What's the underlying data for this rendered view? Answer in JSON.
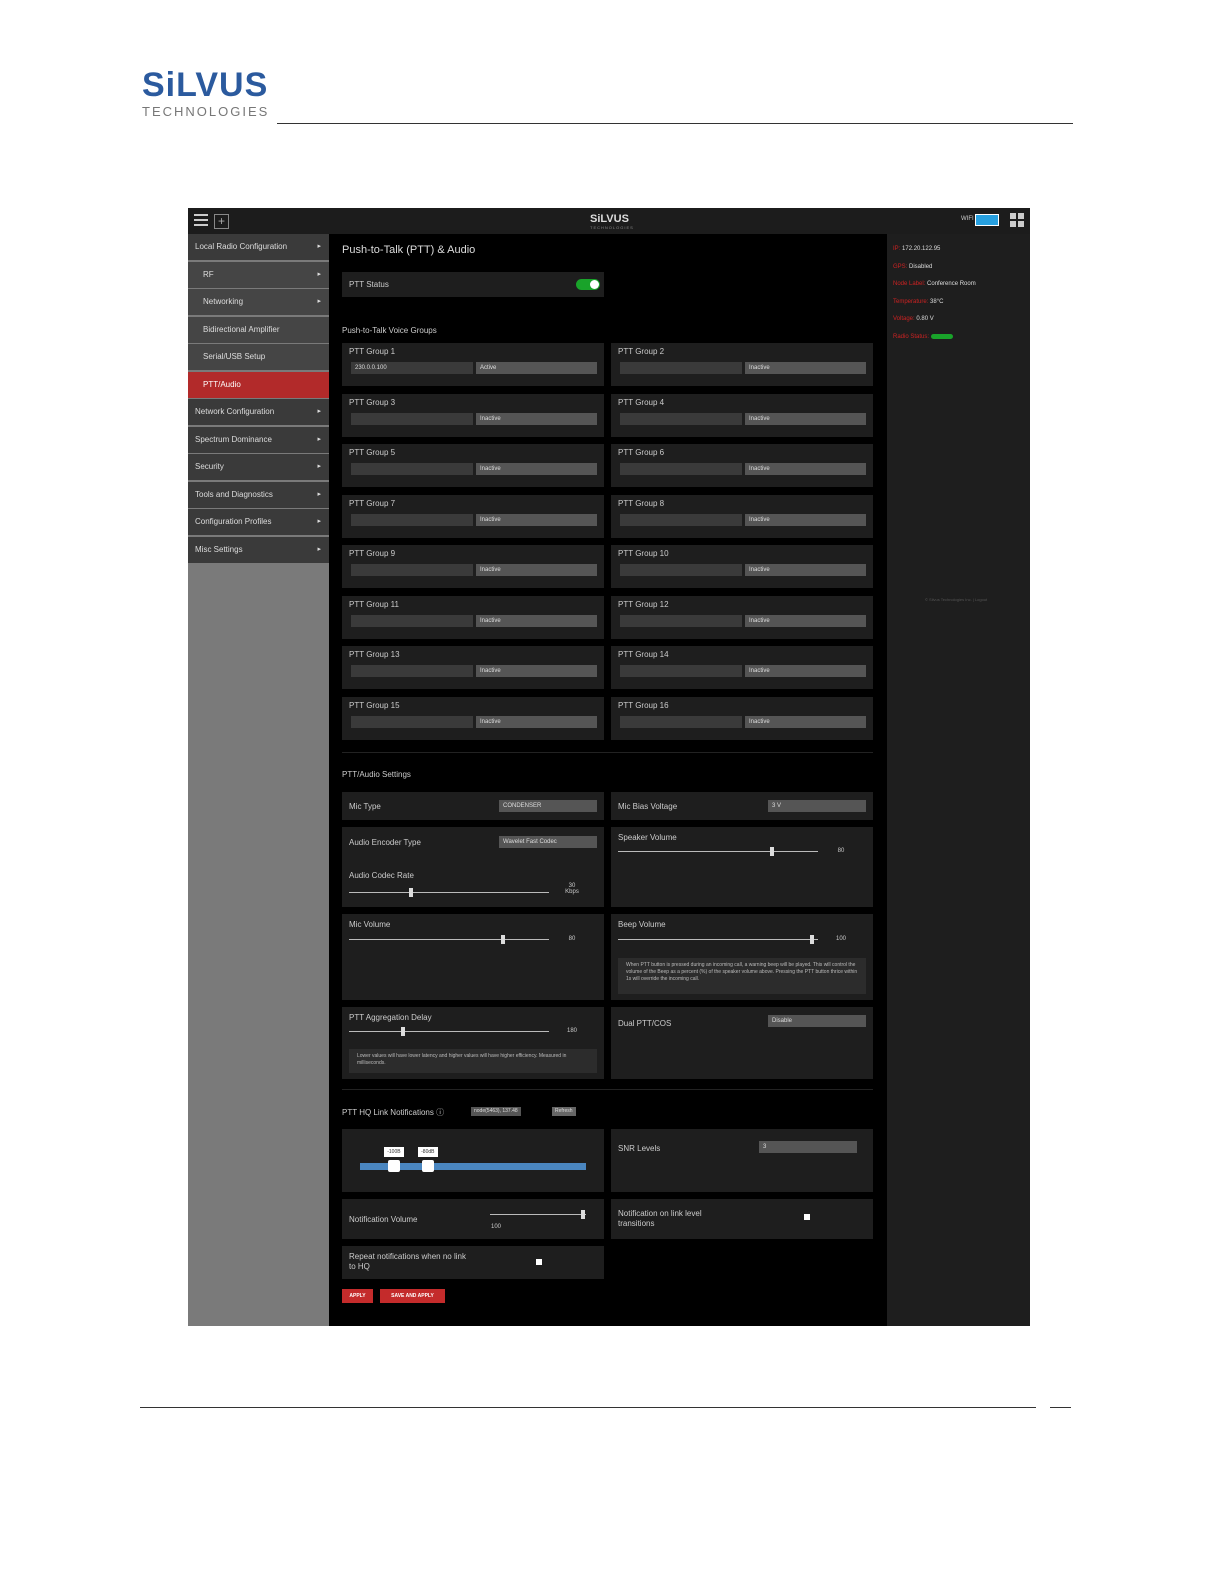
{
  "doc": {
    "logo_main": "SiLVUS",
    "logo_sub": "TECHNOLOGIES"
  },
  "topbar": {
    "logo": "SiLVUS",
    "logo_sub": "TECHNOLOGIES",
    "wifi_label": "WIFI",
    "menu_icon": "hamburger-icon",
    "add_icon": "plus-icon",
    "battery_icon": "battery-icon",
    "apps_icon": "grid-icon"
  },
  "sidebar": {
    "items": [
      {
        "label": "Local Radio Configuration",
        "sub": false,
        "arrow": true,
        "active": false
      },
      {
        "label": "RF",
        "sub": true,
        "arrow": true,
        "active": false
      },
      {
        "label": "Networking",
        "sub": true,
        "arrow": true,
        "active": false
      },
      {
        "label": "Bidirectional Amplifier",
        "sub": true,
        "arrow": false,
        "active": false
      },
      {
        "label": "Serial/USB Setup",
        "sub": true,
        "arrow": false,
        "active": false
      },
      {
        "label": "PTT/Audio",
        "sub": true,
        "arrow": false,
        "active": true
      },
      {
        "label": "Network Configuration",
        "sub": false,
        "arrow": true,
        "active": false
      },
      {
        "label": "Spectrum Dominance",
        "sub": false,
        "arrow": true,
        "active": false
      },
      {
        "label": "Security",
        "sub": false,
        "arrow": true,
        "active": false
      },
      {
        "label": "Tools and Diagnostics",
        "sub": false,
        "arrow": true,
        "active": false
      },
      {
        "label": "Configuration Profiles",
        "sub": false,
        "arrow": true,
        "active": false
      },
      {
        "label": "Misc Settings",
        "sub": false,
        "arrow": true,
        "active": false
      }
    ]
  },
  "main": {
    "title": "Push-to-Talk (PTT) & Audio",
    "ptt_status_label": "PTT Status",
    "ptt_status_on": true,
    "voice_groups_title": "Push-to-Talk Voice Groups",
    "groups": [
      {
        "name": "PTT Group 1",
        "ip": "230.0.0.100",
        "state": "Active"
      },
      {
        "name": "PTT Group 2",
        "ip": "",
        "state": "Inactive"
      },
      {
        "name": "PTT Group 3",
        "ip": "",
        "state": "Inactive"
      },
      {
        "name": "PTT Group 4",
        "ip": "",
        "state": "Inactive"
      },
      {
        "name": "PTT Group 5",
        "ip": "",
        "state": "Inactive"
      },
      {
        "name": "PTT Group 6",
        "ip": "",
        "state": "Inactive"
      },
      {
        "name": "PTT Group 7",
        "ip": "",
        "state": "Inactive"
      },
      {
        "name": "PTT Group 8",
        "ip": "",
        "state": "Inactive"
      },
      {
        "name": "PTT Group 9",
        "ip": "",
        "state": "Inactive"
      },
      {
        "name": "PTT Group 10",
        "ip": "",
        "state": "Inactive"
      },
      {
        "name": "PTT Group 11",
        "ip": "",
        "state": "Inactive"
      },
      {
        "name": "PTT Group 12",
        "ip": "",
        "state": "Inactive"
      },
      {
        "name": "PTT Group 13",
        "ip": "",
        "state": "Inactive"
      },
      {
        "name": "PTT Group 14",
        "ip": "",
        "state": "Inactive"
      },
      {
        "name": "PTT Group 15",
        "ip": "",
        "state": "Inactive"
      },
      {
        "name": "PTT Group 16",
        "ip": "",
        "state": "Inactive"
      }
    ],
    "settings_title": "PTT/Audio Settings",
    "mic_type_label": "Mic Type",
    "mic_type_value": "CONDENSER",
    "mic_bias_label": "Mic Bias Voltage",
    "mic_bias_value": "3 V",
    "encoder_label": "Audio Encoder Type",
    "encoder_value": "Wavelet Fast Codec",
    "speaker_label": "Speaker Volume",
    "speaker_value": "80",
    "speaker_level": 0.77,
    "codec_rate_label": "Audio Codec Rate",
    "codec_rate_value": "30",
    "codec_rate_unit": "Kbps",
    "codec_rate_level": 0.31,
    "mic_vol_label": "Mic Volume",
    "mic_vol_value": "80",
    "mic_vol_level": 0.77,
    "beep_label": "Beep Volume",
    "beep_value": "100",
    "beep_level": 0.97,
    "beep_note": "When PTT button is pressed during an incoming call, a warning beep will be played. This will control the volume of the Beep as a percent (%) of the speaker volume above. Pressing the PTT button thrice within 1s will override the incoming call.",
    "agg_label": "PTT Aggregation Delay",
    "agg_value": "180",
    "agg_level": 0.27,
    "agg_note": "Lower values will have lower latency and higher values will have higher efficiency. Measured in milliseconds.",
    "dual_label": "Dual PTT/COS",
    "dual_value": "Disable",
    "hq_title": "PTT HQ Link Notifications ⓘ",
    "hq_node": "node(5463), 137.48",
    "hq_refresh": "Refresh",
    "hq_low": "-100B",
    "hq_high": "-80dB",
    "hq_low_level": 0.15,
    "hq_high_level": 0.3,
    "snr_label": "SNR Levels",
    "snr_value": "3",
    "notif_vol_label": "Notification Volume",
    "notif_vol_value": "100",
    "notif_vol_level": 0.97,
    "notif_link_label": "Notification on link level transitions",
    "repeat_label": "Repeat notifications when no link to HQ",
    "apply": "APPLY",
    "save_apply": "SAVE AND APPLY"
  },
  "right": {
    "ip_key": "IP:",
    "ip_val": "172.20.122.95",
    "gps_key": "GPS:",
    "gps_val": "Disabled",
    "node_key": "Node Label:",
    "node_val": "Conference Room",
    "temp_key": "Temperature:",
    "temp_val": "38°C",
    "volt_key": "Voltage:",
    "volt_val": "0.80 V",
    "radio_key": "Radio Status:",
    "copyright": "© Silvus Technologies Inc. | Logout"
  }
}
